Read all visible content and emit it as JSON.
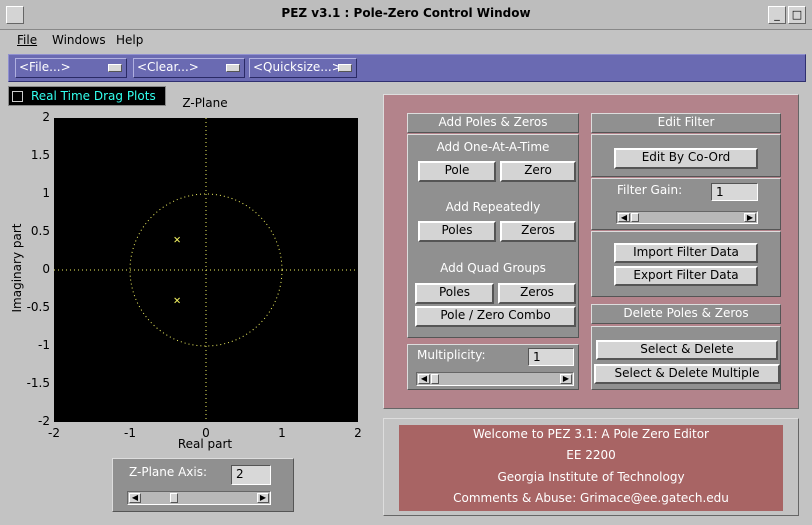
{
  "window": {
    "title": "PEZ v3.1 : Pole-Zero Control Window",
    "min_glyph": "_",
    "max_glyph": "□"
  },
  "menu": {
    "file": "File",
    "windows": "Windows",
    "help": "Help"
  },
  "toolbar": {
    "file_dd": "<File...>",
    "clear_dd": "<Clear...>",
    "quicksize_dd": "<Quicksize...>"
  },
  "realtime_label": "Real Time Drag Plots",
  "plot": {
    "title": "Z-Plane",
    "xlabel": "Real part",
    "ylabel": "Imaginary part",
    "yticks": [
      "2",
      "1.5",
      "1",
      "0.5",
      "0",
      "-0.5",
      "-1",
      "-1.5",
      "-2"
    ],
    "xticks": [
      "-2",
      "-1",
      "0",
      "1",
      "2"
    ],
    "xlim": [
      -2,
      2
    ],
    "ylim": [
      -2,
      2
    ],
    "unit_circle": true,
    "poles": [
      {
        "re": -0.38,
        "im": 0.4
      },
      {
        "re": -0.38,
        "im": -0.4
      }
    ],
    "axis_color": "#f0f060",
    "marker_color": "#f0f060"
  },
  "zaxis": {
    "label": "Z-Plane Axis:",
    "value": "2",
    "slider_position": 0.25
  },
  "add_group": {
    "header": "Add Poles & Zeros",
    "one_label": "Add One-At-A-Time",
    "pole_btn": "Pole",
    "zero_btn": "Zero",
    "rep_label": "Add Repeatedly",
    "poles_btn": "Poles",
    "zeros_btn": "Zeros",
    "quad_label": "Add Quad Groups",
    "quad_poles_btn": "Poles",
    "quad_zeros_btn": "Zeros",
    "combo_btn": "Pole / Zero Combo"
  },
  "multiplicity": {
    "label": "Multiplicity:",
    "value": "1"
  },
  "edit_group": {
    "header": "Edit Filter",
    "coord_btn": "Edit By Co-Ord",
    "gain_label": "Filter Gain:",
    "gain_value": "1",
    "import_btn": "Import Filter Data",
    "export_btn": "Export Filter Data"
  },
  "delete_group": {
    "header": "Delete Poles & Zeros",
    "select_delete_btn": "Select & Delete",
    "select_delete_multi_btn": "Select & Delete Multiple"
  },
  "welcome": {
    "line1": "Welcome to PEZ 3.1: A Pole Zero Editor",
    "line2": "EE 2200",
    "line3": "Georgia Institute of Technology",
    "line4": "Comments & Abuse: Grimace@ee.gatech.edu"
  },
  "colors": {
    "toolbar_bg": "#6a6ab2",
    "panel_rose": "#b3838b",
    "welcome_bg": "#a86464",
    "realtime_text": "#33eeee"
  }
}
